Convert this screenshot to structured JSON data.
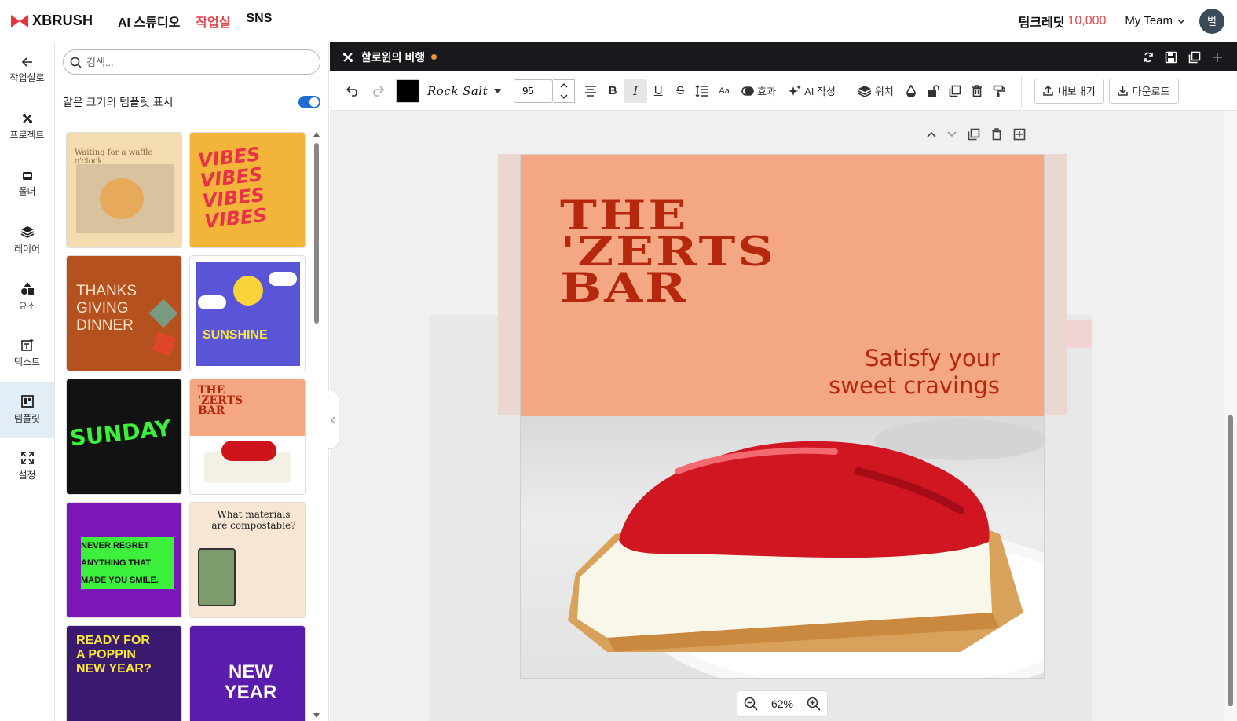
{
  "nav": {
    "brand": "XBRUSH",
    "links": [
      "AI 스튜디오",
      "작업실",
      "SNS"
    ],
    "active_link": "작업실",
    "credit_label": "팀크레딧",
    "credit_value": "10,000",
    "team": "My Team",
    "avatar_initial": "별"
  },
  "rail": {
    "items": [
      {
        "label": "작업실로",
        "icon": "arrow-left-icon"
      },
      {
        "label": "프로젝트",
        "icon": "project-icon"
      },
      {
        "label": "폴더",
        "icon": "folder-icon"
      },
      {
        "label": "레이어",
        "icon": "layers-icon"
      },
      {
        "label": "요소",
        "icon": "shapes-icon"
      },
      {
        "label": "텍스트",
        "icon": "text-icon"
      },
      {
        "label": "템플릿",
        "icon": "template-icon"
      },
      {
        "label": "설정",
        "icon": "expand-icon"
      }
    ],
    "active": "템플릿"
  },
  "panel": {
    "search_placeholder": "검색...",
    "same_size_label": "같은 크기의 템플릿 표시",
    "same_size_on": true,
    "templates": [
      {
        "name": "waffle",
        "text": "Waiting for a waffle o'clock",
        "bg": "#f3ddb0"
      },
      {
        "name": "vibes",
        "text": "VIBES VIBES VIBES VIBES",
        "bg": "#f2b53a"
      },
      {
        "name": "thanksgiving",
        "text": "THANKS GIVING DINNER",
        "bg": "#b5501f"
      },
      {
        "name": "sunshine",
        "text": "SUNSHINE",
        "bg": "#5a55d6"
      },
      {
        "name": "sunday",
        "text": "SUNDAY",
        "bg": "#121212"
      },
      {
        "name": "zerts",
        "text": "THE 'ZERTS BAR",
        "bg": "#f4a783"
      },
      {
        "name": "never-regret",
        "text": "NEVER REGRET ANYTHING THAT MADE YOU SMILE.",
        "bg": "#7b16b8"
      },
      {
        "name": "compostable",
        "text": "What materials are compostable?",
        "bg": "#f7e6d4"
      },
      {
        "name": "poppin",
        "text": "READY FOR A POPPIN NEW YEAR?",
        "bg": "#3a1a6e"
      },
      {
        "name": "new-year",
        "text": "NEW YEAR",
        "bg": "#5a1cad"
      }
    ]
  },
  "editor": {
    "doc_title": "할로윈의 비행",
    "font_name": "Rock Salt",
    "font_size": "95",
    "effect_label": "효과",
    "ai_label": "AI 작성",
    "position_label": "위치",
    "export_label": "내보내기",
    "download_label": "다운로드",
    "text_color": "#000000"
  },
  "canvas": {
    "headline": "THE\n'ZERTS\nBAR",
    "tagline_1": "Satisfy your",
    "tagline_2": "sweet cravings",
    "zoom": "62%",
    "bg_color": "#f4a783",
    "text_color": "#b5280e"
  }
}
